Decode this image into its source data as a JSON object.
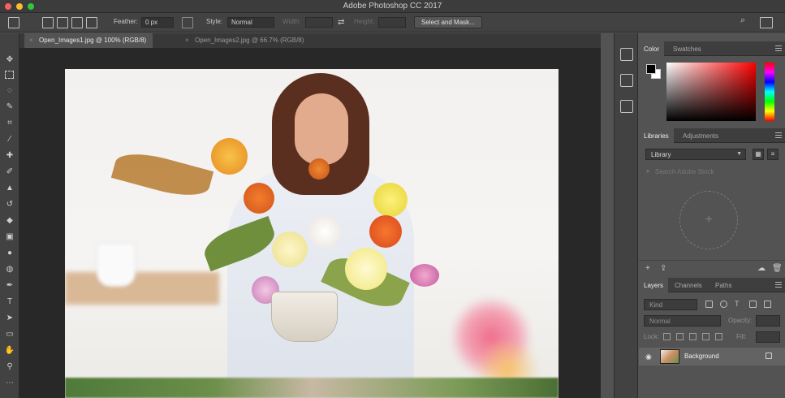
{
  "window": {
    "title": "Adobe Photoshop CC 2017"
  },
  "options_bar": {
    "feather_label": "Feather:",
    "feather_value": "0 px",
    "style_label": "Style:",
    "style_value": "Normal",
    "width_label": "Width:",
    "height_label": "Height:",
    "select_mask_label": "Select and Mask..."
  },
  "document_tabs": [
    {
      "label": "Open_Images1.jpg @ 100% (RGB/8)",
      "active": true
    },
    {
      "label": "Open_Images2.jpg @ 66.7% (RGB/8)",
      "active": false
    }
  ],
  "tools": [
    "move-tool",
    "marquee-tool",
    "lasso-tool",
    "quick-select-tool",
    "crop-tool",
    "eyedropper-tool",
    "healing-tool",
    "brush-tool",
    "stamp-tool",
    "history-brush-tool",
    "eraser-tool",
    "gradient-tool",
    "blur-tool",
    "dodge-tool",
    "pen-tool",
    "type-tool",
    "path-select-tool",
    "rectangle-tool",
    "hand-tool",
    "zoom-tool"
  ],
  "type_tool_glyph": "T",
  "color_panel": {
    "tabs": [
      "Color",
      "Swatches"
    ],
    "foreground": "#000000",
    "background": "#ffffff"
  },
  "libraries_panel": {
    "tabs": [
      "Libraries",
      "Adjustments"
    ],
    "library_select": "Library",
    "search_placeholder": "Search Adobe Stock"
  },
  "layers_panel": {
    "tabs": [
      "Layers",
      "Channels",
      "Paths"
    ],
    "kind_filter": "Kind",
    "blend_mode": "Normal",
    "opacity_label": "Opacity:",
    "lock_label": "Lock:",
    "fill_label": "Fill:",
    "layers": [
      {
        "name": "Background",
        "visible": true,
        "locked": true
      }
    ]
  }
}
